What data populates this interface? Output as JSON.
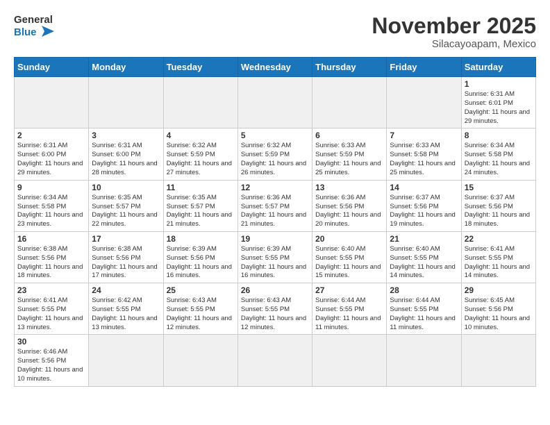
{
  "header": {
    "logo_general": "General",
    "logo_blue": "Blue",
    "month": "November 2025",
    "location": "Silacayoapam, Mexico"
  },
  "weekdays": [
    "Sunday",
    "Monday",
    "Tuesday",
    "Wednesday",
    "Thursday",
    "Friday",
    "Saturday"
  ],
  "weeks": [
    [
      {
        "day": "",
        "info": ""
      },
      {
        "day": "",
        "info": ""
      },
      {
        "day": "",
        "info": ""
      },
      {
        "day": "",
        "info": ""
      },
      {
        "day": "",
        "info": ""
      },
      {
        "day": "",
        "info": ""
      },
      {
        "day": "1",
        "info": "Sunrise: 6:31 AM\nSunset: 6:01 PM\nDaylight: 11 hours and 29 minutes."
      }
    ],
    [
      {
        "day": "2",
        "info": "Sunrise: 6:31 AM\nSunset: 6:00 PM\nDaylight: 11 hours and 29 minutes."
      },
      {
        "day": "3",
        "info": "Sunrise: 6:31 AM\nSunset: 6:00 PM\nDaylight: 11 hours and 28 minutes."
      },
      {
        "day": "4",
        "info": "Sunrise: 6:32 AM\nSunset: 5:59 PM\nDaylight: 11 hours and 27 minutes."
      },
      {
        "day": "5",
        "info": "Sunrise: 6:32 AM\nSunset: 5:59 PM\nDaylight: 11 hours and 26 minutes."
      },
      {
        "day": "6",
        "info": "Sunrise: 6:33 AM\nSunset: 5:59 PM\nDaylight: 11 hours and 25 minutes."
      },
      {
        "day": "7",
        "info": "Sunrise: 6:33 AM\nSunset: 5:58 PM\nDaylight: 11 hours and 25 minutes."
      },
      {
        "day": "8",
        "info": "Sunrise: 6:34 AM\nSunset: 5:58 PM\nDaylight: 11 hours and 24 minutes."
      }
    ],
    [
      {
        "day": "9",
        "info": "Sunrise: 6:34 AM\nSunset: 5:58 PM\nDaylight: 11 hours and 23 minutes."
      },
      {
        "day": "10",
        "info": "Sunrise: 6:35 AM\nSunset: 5:57 PM\nDaylight: 11 hours and 22 minutes."
      },
      {
        "day": "11",
        "info": "Sunrise: 6:35 AM\nSunset: 5:57 PM\nDaylight: 11 hours and 21 minutes."
      },
      {
        "day": "12",
        "info": "Sunrise: 6:36 AM\nSunset: 5:57 PM\nDaylight: 11 hours and 21 minutes."
      },
      {
        "day": "13",
        "info": "Sunrise: 6:36 AM\nSunset: 5:56 PM\nDaylight: 11 hours and 20 minutes."
      },
      {
        "day": "14",
        "info": "Sunrise: 6:37 AM\nSunset: 5:56 PM\nDaylight: 11 hours and 19 minutes."
      },
      {
        "day": "15",
        "info": "Sunrise: 6:37 AM\nSunset: 5:56 PM\nDaylight: 11 hours and 18 minutes."
      }
    ],
    [
      {
        "day": "16",
        "info": "Sunrise: 6:38 AM\nSunset: 5:56 PM\nDaylight: 11 hours and 18 minutes."
      },
      {
        "day": "17",
        "info": "Sunrise: 6:38 AM\nSunset: 5:56 PM\nDaylight: 11 hours and 17 minutes."
      },
      {
        "day": "18",
        "info": "Sunrise: 6:39 AM\nSunset: 5:56 PM\nDaylight: 11 hours and 16 minutes."
      },
      {
        "day": "19",
        "info": "Sunrise: 6:39 AM\nSunset: 5:55 PM\nDaylight: 11 hours and 16 minutes."
      },
      {
        "day": "20",
        "info": "Sunrise: 6:40 AM\nSunset: 5:55 PM\nDaylight: 11 hours and 15 minutes."
      },
      {
        "day": "21",
        "info": "Sunrise: 6:40 AM\nSunset: 5:55 PM\nDaylight: 11 hours and 14 minutes."
      },
      {
        "day": "22",
        "info": "Sunrise: 6:41 AM\nSunset: 5:55 PM\nDaylight: 11 hours and 14 minutes."
      }
    ],
    [
      {
        "day": "23",
        "info": "Sunrise: 6:41 AM\nSunset: 5:55 PM\nDaylight: 11 hours and 13 minutes."
      },
      {
        "day": "24",
        "info": "Sunrise: 6:42 AM\nSunset: 5:55 PM\nDaylight: 11 hours and 13 minutes."
      },
      {
        "day": "25",
        "info": "Sunrise: 6:43 AM\nSunset: 5:55 PM\nDaylight: 11 hours and 12 minutes."
      },
      {
        "day": "26",
        "info": "Sunrise: 6:43 AM\nSunset: 5:55 PM\nDaylight: 11 hours and 12 minutes."
      },
      {
        "day": "27",
        "info": "Sunrise: 6:44 AM\nSunset: 5:55 PM\nDaylight: 11 hours and 11 minutes."
      },
      {
        "day": "28",
        "info": "Sunrise: 6:44 AM\nSunset: 5:55 PM\nDaylight: 11 hours and 11 minutes."
      },
      {
        "day": "29",
        "info": "Sunrise: 6:45 AM\nSunset: 5:56 PM\nDaylight: 11 hours and 10 minutes."
      }
    ],
    [
      {
        "day": "30",
        "info": "Sunrise: 6:46 AM\nSunset: 5:56 PM\nDaylight: 11 hours and 10 minutes."
      },
      {
        "day": "",
        "info": ""
      },
      {
        "day": "",
        "info": ""
      },
      {
        "day": "",
        "info": ""
      },
      {
        "day": "",
        "info": ""
      },
      {
        "day": "",
        "info": ""
      },
      {
        "day": "",
        "info": ""
      }
    ]
  ]
}
